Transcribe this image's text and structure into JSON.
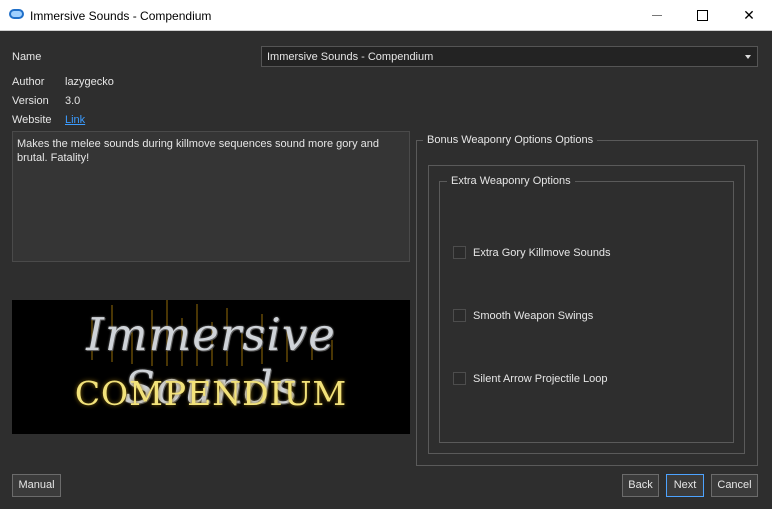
{
  "window": {
    "title": "Immersive Sounds - Compendium"
  },
  "fields": {
    "name_label": "Name",
    "name_value": "Immersive Sounds - Compendium",
    "author_label": "Author",
    "author_value": "lazygecko",
    "version_label": "Version",
    "version_value": "3.0",
    "website_label": "Website",
    "website_link": "Link"
  },
  "description": "Makes the melee sounds during killmove sequences sound more gory and brutal. Fatality!",
  "banner": {
    "line1": "Immersive Sounds",
    "line2": "COMPENDIUM"
  },
  "options": {
    "group_title": "Bonus Weaponry Options Options",
    "subgroup_title": "Extra Weaponry Options",
    "items": [
      {
        "label": "Extra Gory Killmove Sounds",
        "checked": false
      },
      {
        "label": "Smooth Weapon Swings",
        "checked": false
      },
      {
        "label": "Silent Arrow Projectile Loop",
        "checked": false
      }
    ]
  },
  "buttons": {
    "manual": "Manual",
    "back": "Back",
    "next": "Next",
    "cancel": "Cancel"
  },
  "colors": {
    "background": "#2e2e2e",
    "accent": "#4da3ff",
    "link": "#3b9cff",
    "banner_gold": "#f2e27a"
  }
}
